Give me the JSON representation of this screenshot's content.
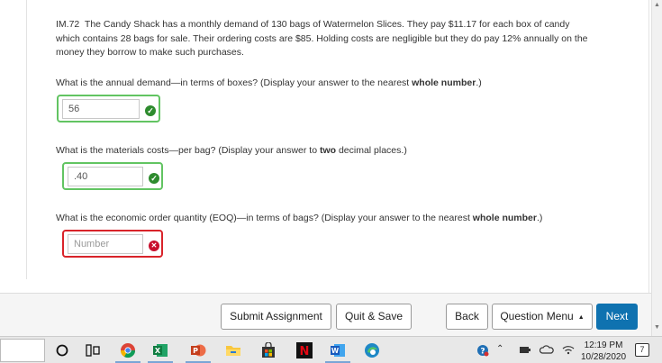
{
  "problem": {
    "id": "IM.72",
    "text": "The Candy Shack has a monthly demand of 130 bags of Watermelon Slices. They pay $11.17 for each box of candy which contains 28 bags for sale. Their ordering costs are $85. Holding costs are negligible but they do pay 12% annually on the money they borrow to make such purchases."
  },
  "questions": [
    {
      "pre": "What is the annual demand—in terms of boxes? (Display your answer to the nearest ",
      "bold": "whole number",
      "post": ".)",
      "value": "56",
      "placeholder": "",
      "status": "correct"
    },
    {
      "pre": "What is the materials costs—per bag? (Display your answer to ",
      "bold": "two",
      "post": " decimal places.)",
      "value": ".40",
      "placeholder": "",
      "status": "correct"
    },
    {
      "pre": "What is the economic order quantity (EOQ)—in terms of bags? (Display your answer to the nearest ",
      "bold": "whole number",
      "post": ".)",
      "value": "",
      "placeholder": "Number",
      "status": "incorrect"
    }
  ],
  "footer": {
    "submit": "Submit Assignment",
    "quit": "Quit & Save",
    "back": "Back",
    "menu": "Question Menu",
    "next": "Next"
  },
  "taskbar": {
    "time": "12:19 PM",
    "date": "10/28/2020",
    "notifications": "7"
  },
  "colors": {
    "correct_border": "#62c462",
    "incorrect_border": "#d9232a",
    "next_button": "#0f72b0"
  }
}
